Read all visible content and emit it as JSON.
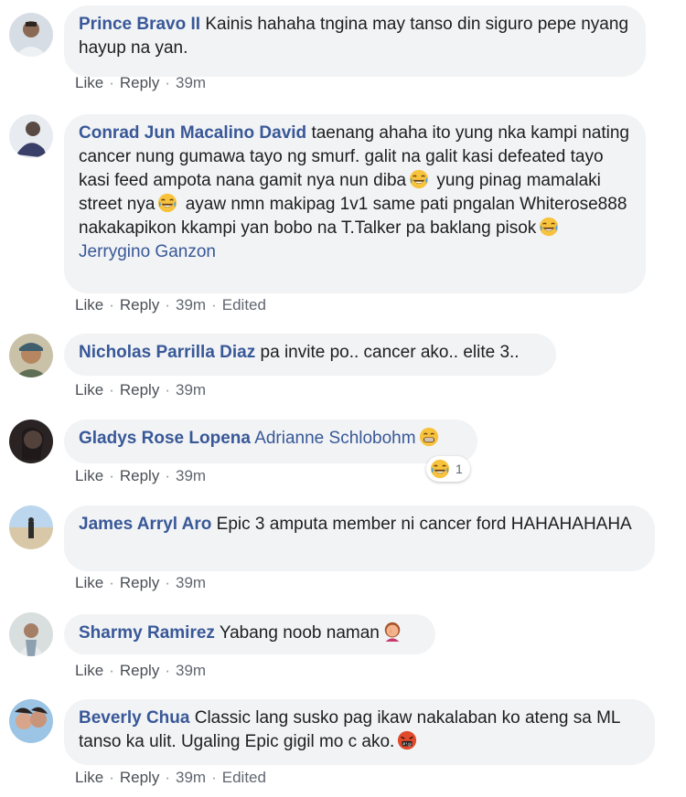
{
  "actions": {
    "like": "Like",
    "reply": "Reply",
    "edited": "Edited"
  },
  "comments": [
    {
      "author": "Prince Bravo II",
      "text": "Kainis hahaha tngina may tanso din siguro pepe nyang hayup na yan.",
      "time": "39m"
    },
    {
      "author": "Conrad Jun Macalino David",
      "t1": "taenang ahaha ito yung nka kampi nating cancer nung gumawa tayo ng smurf. galit na galit kasi defeated tayo kasi feed ampota nana gamit nya nun diba",
      "t2": "yung pinag mamalaki street nya",
      "t3": "ayaw nmn makipag 1v1 same pati pngalan Whiterose888",
      "t4": "nakakapikon kkampi yan bobo na T.Talker pa baklang pisok",
      "mention": "Jerrygino Ganzon",
      "time": "39m",
      "edited": "Edited"
    },
    {
      "author": "Nicholas Parrilla Diaz",
      "text": "pa invite po.. cancer ako.. elite 3..",
      "time": "39m"
    },
    {
      "author": "Gladys Rose Lopena",
      "mention": "Adrianne Schlobohm",
      "reaction_count": "1",
      "time": "39m"
    },
    {
      "author": "James Arryl Aro",
      "text": "Epic 3 amputa member ni cancer ford HAHAHAHAHA",
      "time": "39m"
    },
    {
      "author": "Sharmy Ramirez",
      "text": "Yabang noob naman",
      "time": "39m"
    },
    {
      "author": "Beverly Chua",
      "text": "Classic lang susko pag ikaw nakalaban ko ateng sa ML tanso ka ulit. Ugaling Epic gigil mo c ako.",
      "time": "39m",
      "edited": "Edited"
    }
  ],
  "icons": {
    "laughing": "face-with-tears-of-joy-icon",
    "grin": "grinning-face-icon",
    "facepalm": "woman-facepalming-icon",
    "angry": "face-with-symbols-icon"
  },
  "colors": {
    "author": "#385898",
    "bubble": "#f2f3f5",
    "meta": "#606770"
  }
}
